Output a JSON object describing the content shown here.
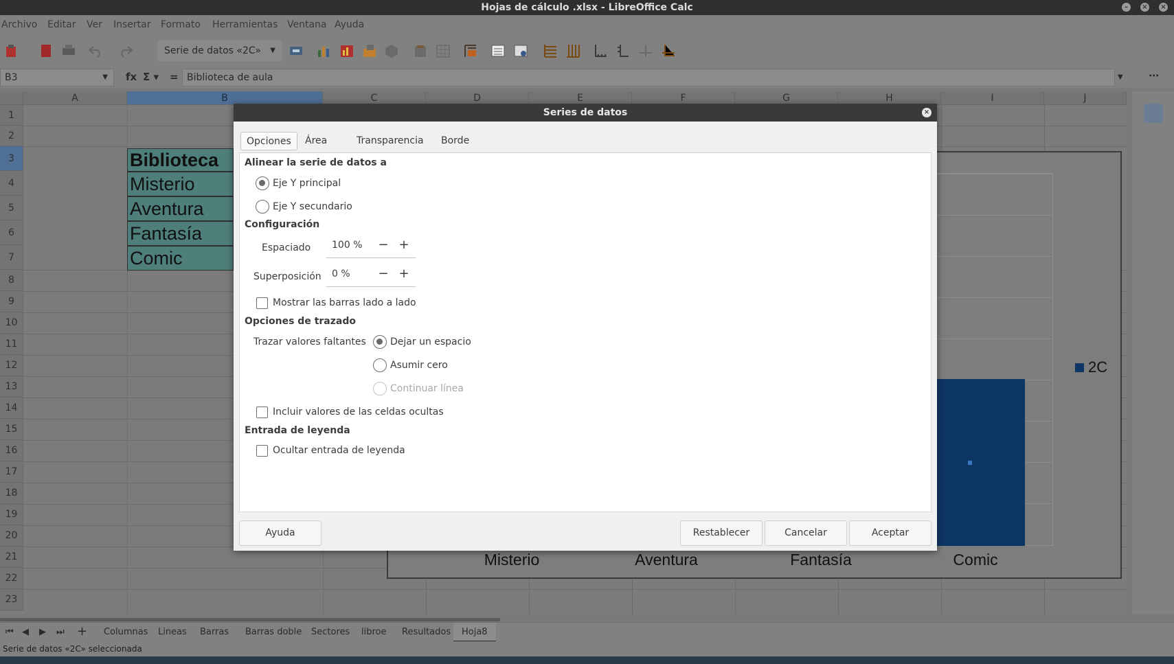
{
  "window": {
    "title": "Hojas de cálculo .xlsx - LibreOffice Calc"
  },
  "menu": [
    "Archivo",
    "Editar",
    "Ver",
    "Insertar",
    "Formato",
    "Herramientas",
    "Ventana",
    "Ayuda"
  ],
  "toolbar": {
    "selection_combo": "Serie de datos «2C»"
  },
  "formula_bar": {
    "cell_ref": "B3",
    "content": "Biblioteca de aula"
  },
  "grid": {
    "columns": [
      "A",
      "B",
      "C",
      "D",
      "E",
      "F",
      "G",
      "H",
      "I",
      "J"
    ],
    "selected_column": "B",
    "rows": [
      "1",
      "2",
      "3",
      "4",
      "5",
      "6",
      "7",
      "8",
      "9",
      "10",
      "11",
      "12",
      "13",
      "14",
      "15",
      "16",
      "17",
      "18",
      "19",
      "20",
      "21",
      "22",
      "23"
    ],
    "selected_row": "3",
    "cells": {
      "b3": "Biblioteca",
      "b4": "Misterio",
      "b5": "Aventura",
      "b6": "Fantasía",
      "b7": "Comic"
    }
  },
  "chart_data": {
    "type": "bar",
    "categories": [
      "Misterio",
      "Aventura",
      "Fantasía",
      "Comic"
    ],
    "series": [
      {
        "name": "2C",
        "values": [
          null,
          null,
          null,
          10
        ],
        "color": "#0d3666"
      }
    ],
    "legend_position": "right",
    "grid": true
  },
  "dialog": {
    "title": "Series de datos",
    "tabs": [
      "Opciones",
      "Área",
      "Transparencia",
      "Borde"
    ],
    "active_tab": "Opciones",
    "align_section": "Alinear la serie de datos a",
    "align_primary": "Eje Y principal",
    "align_secondary": "Eje Y secundario",
    "config_section": "Configuración",
    "spacing_label": "Espaciado",
    "spacing_value": "100 %",
    "overlap_label": "Superposición",
    "overlap_value": "0 %",
    "side_by_side": "Mostrar las barras lado a lado",
    "plot_section": "Opciones de trazado",
    "missing_label": "Trazar valores faltantes",
    "missing_gap": "Dejar un espacio",
    "missing_zero": "Asumir cero",
    "missing_continue": "Continuar línea",
    "hidden_cells": "Incluir valores de las celdas ocultas",
    "legend_section": "Entrada de leyenda",
    "hide_legend": "Ocultar entrada de leyenda",
    "btn_help": "Ayuda",
    "btn_reset": "Restablecer",
    "btn_cancel": "Cancelar",
    "btn_ok": "Aceptar"
  },
  "sheets": [
    "Columnas",
    "Lineas",
    "Barras",
    "Barras doble",
    "Sectores",
    "libroe",
    "Resultados",
    "Hoja8"
  ],
  "active_sheet": "Hoja8",
  "status": "Serie de datos «2C» seleccionada",
  "colors": {
    "accent": "#0d3666",
    "teal_cell": "#4f7f7a",
    "selection": "#4f6f97"
  }
}
